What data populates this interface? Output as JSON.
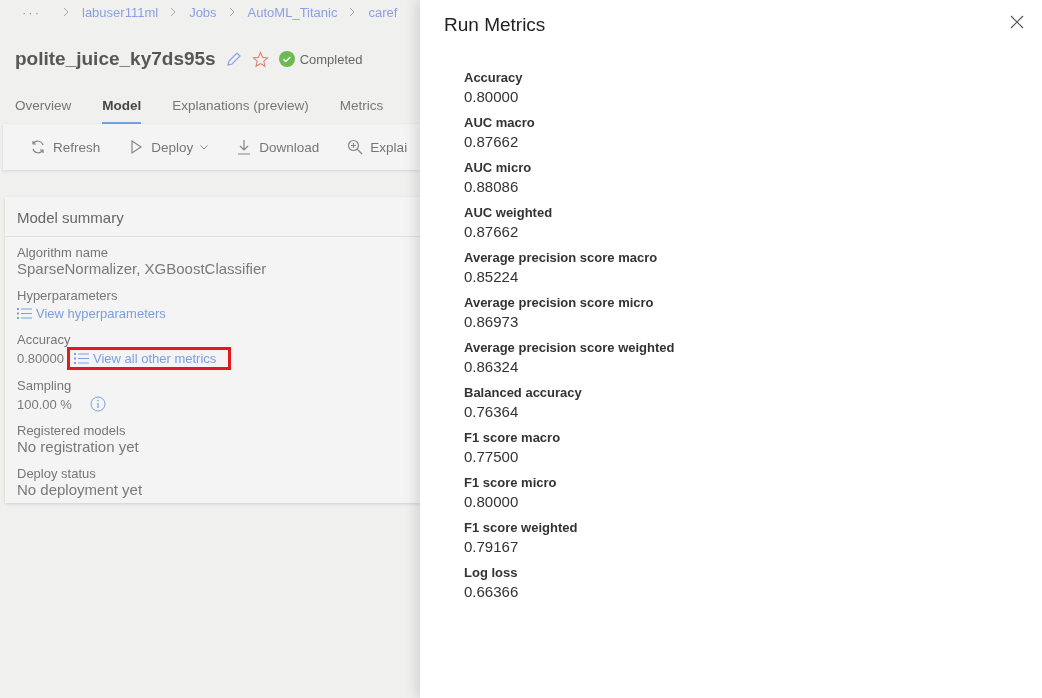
{
  "breadcrumb": {
    "overflow": "···",
    "items": [
      "labuser111ml",
      "Jobs",
      "AutoML_Titanic",
      "caref"
    ]
  },
  "run": {
    "title": "polite_juice_ky7ds95s",
    "favorite": false,
    "status": "Completed"
  },
  "tabs": [
    {
      "label": "Overview",
      "selected": false
    },
    {
      "label": "Model",
      "selected": true
    },
    {
      "label": "Explanations (preview)",
      "selected": false
    },
    {
      "label": "Metrics",
      "selected": false
    }
  ],
  "toolbar": [
    {
      "kind": "refresh",
      "label": "Refresh"
    },
    {
      "kind": "deploy",
      "label": "Deploy"
    },
    {
      "kind": "download",
      "label": "Download"
    },
    {
      "kind": "explain",
      "label": "Explai"
    }
  ],
  "model_summary": {
    "title": "Model summary",
    "fields": [
      {
        "kind": "text",
        "label": "Algorithm name",
        "value": "SparseNormalizer, XGBoostClassifier"
      },
      {
        "kind": "link",
        "label": "Hyperparameters",
        "link": "View hyperparameters",
        "highlighted": false
      },
      {
        "kind": "value_link",
        "label": "Accuracy",
        "value": "0.80000",
        "link": "View all other metrics",
        "highlighted": true
      },
      {
        "kind": "info",
        "label": "Sampling",
        "value": "100.00 %"
      },
      {
        "kind": "text",
        "label": "Registered models",
        "value": "No registration yet"
      },
      {
        "kind": "text",
        "label": "Deploy status",
        "value": "No deployment yet"
      }
    ]
  },
  "run_metrics_panel": {
    "title": "Run Metrics",
    "metrics": [
      {
        "name": "Accuracy",
        "value": "0.80000"
      },
      {
        "name": "AUC macro",
        "value": "0.87662"
      },
      {
        "name": "AUC micro",
        "value": "0.88086"
      },
      {
        "name": "AUC weighted",
        "value": "0.87662"
      },
      {
        "name": "Average precision score macro",
        "value": "0.85224"
      },
      {
        "name": "Average precision score micro",
        "value": "0.86973"
      },
      {
        "name": "Average precision score weighted",
        "value": "0.86324"
      },
      {
        "name": "Balanced accuracy",
        "value": "0.76364"
      },
      {
        "name": "F1 score macro",
        "value": "0.77500"
      },
      {
        "name": "F1 score micro",
        "value": "0.80000"
      },
      {
        "name": "F1 score weighted",
        "value": "0.79167"
      },
      {
        "name": "Log loss",
        "value": "0.66366"
      }
    ]
  }
}
